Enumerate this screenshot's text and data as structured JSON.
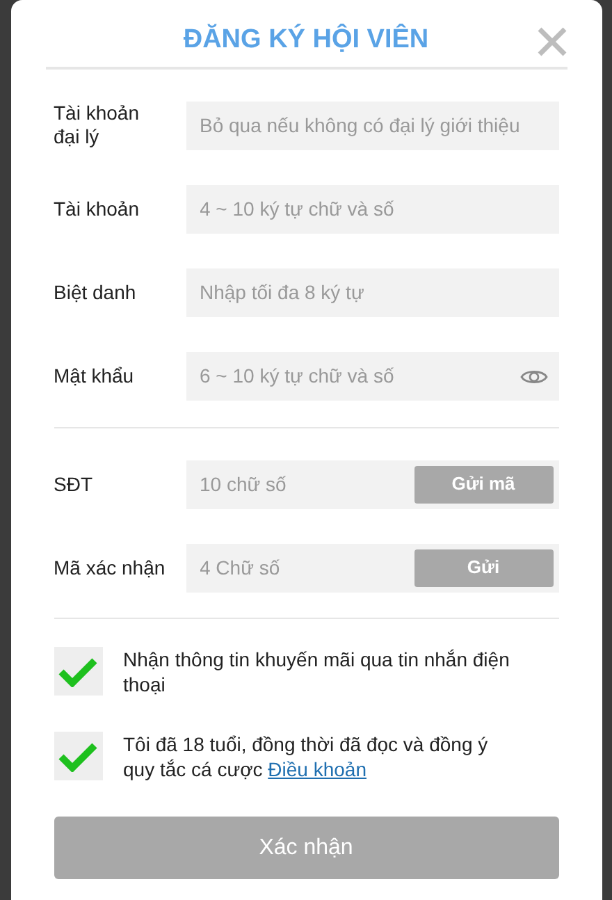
{
  "dialog": {
    "title": "ĐĂNG KÝ HỘI VIÊN"
  },
  "account_fields": [
    {
      "kind": "text",
      "label": "Tài khoản đại lý",
      "placeholder": "Bỏ qua nếu không có đại lý giới thiệu"
    },
    {
      "kind": "text",
      "label": "Tài khoản",
      "placeholder": "4 ~ 10 ký tự chữ và số"
    },
    {
      "kind": "text",
      "label": "Biệt danh",
      "placeholder": "Nhập tối đa 8 ký tự"
    },
    {
      "kind": "password",
      "label": "Mật khẩu",
      "placeholder": "6 ~ 10 ký tự chữ và số"
    }
  ],
  "verify_fields": [
    {
      "kind": "code",
      "label": "SĐT",
      "placeholder": "10 chữ số",
      "button": "Gửi mã"
    },
    {
      "kind": "code",
      "label": "Mã xác nhận",
      "placeholder": "4 Chữ số",
      "button": "Gửi"
    }
  ],
  "agreements": [
    {
      "checked": true,
      "text": "Nhận thông tin khuyến mãi qua tin nhắn điện thoại"
    },
    {
      "checked": true,
      "text": "Tôi đã 18 tuổi, đồng thời đã đọc và đồng ý quy tắc cá cược",
      "link": "Điều khoản"
    }
  ],
  "submit_button": "Xác nhận"
}
